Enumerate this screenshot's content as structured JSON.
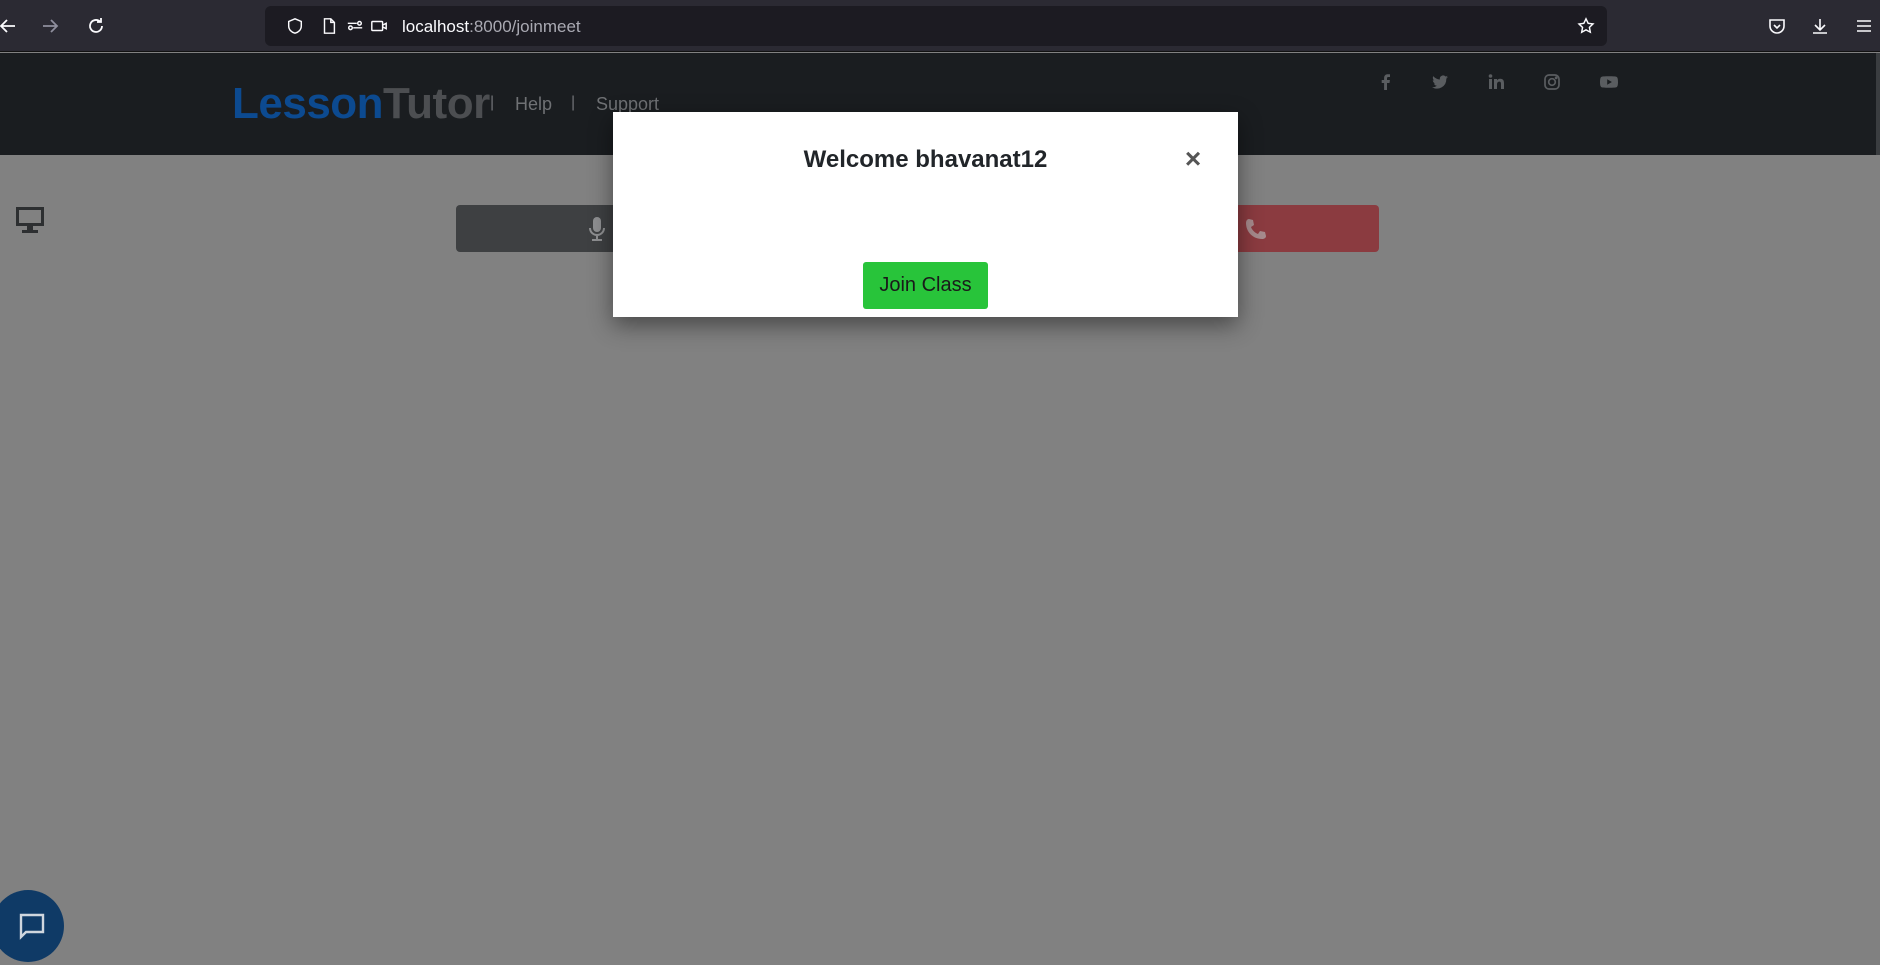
{
  "browser": {
    "url_host": "localhost",
    "url_path": ":8000/joinmeet",
    "icons": [
      "back-icon",
      "forward-icon",
      "reload-icon",
      "shield-icon",
      "page-icon",
      "permissions-icon",
      "camera-icon",
      "star-icon",
      "pocket-icon",
      "download-icon",
      "menu-icon"
    ]
  },
  "header": {
    "logo_part1": "Lesson",
    "logo_part2": "Tutor",
    "separator": "|",
    "links": [
      "Help",
      "Support"
    ],
    "social_icons": [
      "facebook-icon",
      "twitter-icon",
      "linkedin-icon",
      "instagram-icon",
      "youtube-icon"
    ]
  },
  "modal": {
    "title": "Welcome bhavanat12",
    "close_symbol": "×",
    "join_label": "Join Class"
  },
  "colors": {
    "brand_blue": "#0c4a90",
    "join_green": "#28c43a",
    "end_red": "#8b3b40",
    "overlay_grey": "#818181"
  }
}
